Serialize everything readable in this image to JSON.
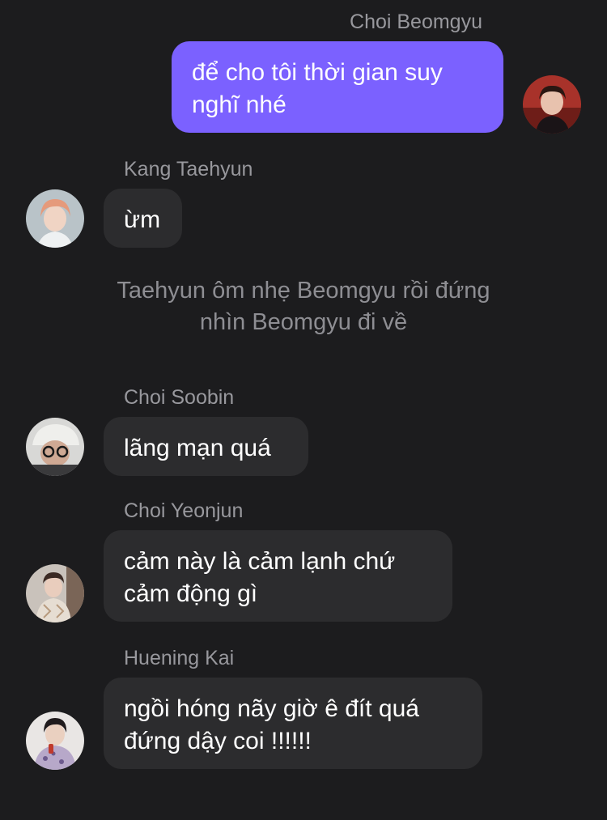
{
  "messages": [
    {
      "sender": "Choi Beomgyu",
      "lines": [
        "để cho tôi thời gian suy",
        "nghĩ nhé"
      ],
      "direction": "outgoing"
    },
    {
      "sender": "Kang Taehyun",
      "lines": [
        "ừm"
      ],
      "direction": "incoming"
    },
    {
      "sender": "Choi Soobin",
      "lines": [
        "lãng mạn quá"
      ],
      "direction": "incoming"
    },
    {
      "sender": "Choi Yeonjun",
      "lines": [
        "cảm này là cảm lạnh chứ",
        "cảm động gì"
      ],
      "direction": "incoming"
    },
    {
      "sender": "Huening Kai",
      "lines": [
        "ngồi hóng nãy giờ ê đít quá",
        "đứng dậy coi !!!!!!"
      ],
      "direction": "incoming"
    }
  ],
  "narration": {
    "lines": [
      "Taehyun ôm nhẹ Beomgyu rồi đứng",
      "nhìn Beomgyu đi về"
    ]
  },
  "colors": {
    "background": "#1c1c1e",
    "incoming_bubble": "#2c2c2e",
    "outgoing_bubble": "#7b61ff",
    "sender_name": "#98989d",
    "narration_text": "#8e8e93"
  }
}
